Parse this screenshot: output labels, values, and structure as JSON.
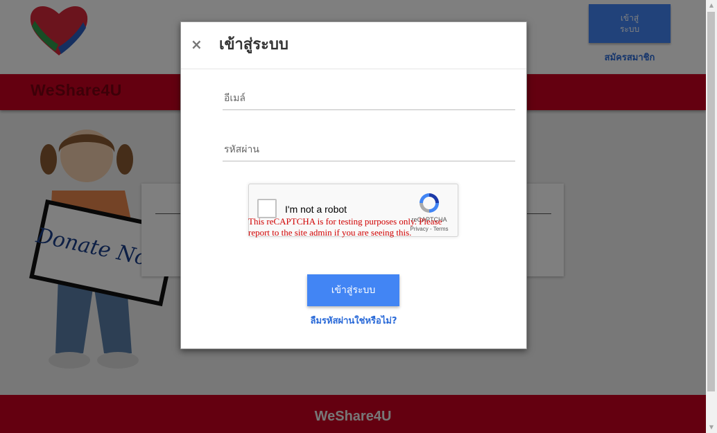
{
  "header": {
    "login_button": "เข้าสู่ระบบ",
    "register_link": "สมัครสมาชิก"
  },
  "navbar": {
    "brand": "WeShare4U"
  },
  "hero_sign": {
    "text": "Donate Now!"
  },
  "footer": {
    "brand": "WeShare4U"
  },
  "modal": {
    "close_label": "×",
    "title": "เข้าสู่ระบบ",
    "email_placeholder": "อีเมล์",
    "password_placeholder": "รหัสผ่าน",
    "recaptcha": {
      "label": "I'm not a robot",
      "brand": "reCAPTCHA",
      "privacy": "Privacy - Terms",
      "warning": "This reCAPTCHA is for testing purposes only. Please report to the site admin if you are seeing this."
    },
    "submit_label": "เข้าสู่ระบบ",
    "forgot_link": "ลืมรหัสผ่านใช่หรือไม่?"
  },
  "colors": {
    "brand_red": "#c80020",
    "accent_blue": "#4285f4",
    "link_blue": "#2a6ad8",
    "warning_red": "#d00000"
  },
  "icons": [
    "heart-hands-logo",
    "close-icon",
    "recaptcha-icon",
    "scroll-up-icon",
    "scroll-down-icon"
  ]
}
